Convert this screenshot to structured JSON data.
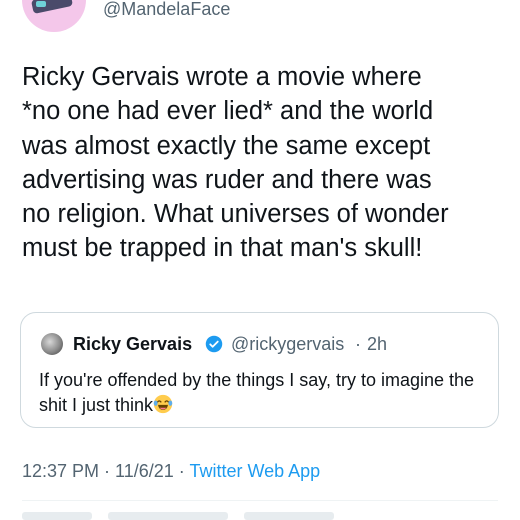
{
  "author": {
    "handle": "@MandelaFace"
  },
  "tweet": {
    "text": "Ricky Gervais wrote a movie where\n*no one had ever lied* and the world\nwas almost exactly the same except\nadvertising was ruder and there was\nno religion. What universes of wonder\nmust be trapped in that man's skull!"
  },
  "quoted_tweet": {
    "name": "Ricky Gervais",
    "handle": "@rickygervais",
    "separator": "·",
    "time": "2h",
    "text": "If you're offended by the things I say, try to imagine the shit I just think",
    "emoji": "face-with-tears-of-joy"
  },
  "meta": {
    "time": "12:37 PM",
    "separator1": " · ",
    "date": "11/6/21",
    "separator2": " · ",
    "source": "Twitter Web App"
  },
  "colors": {
    "text": "#0f1419",
    "secondary": "#536471",
    "link": "#1d9bf0",
    "border": "#cfd9de",
    "verified": "#1d9bf0"
  }
}
